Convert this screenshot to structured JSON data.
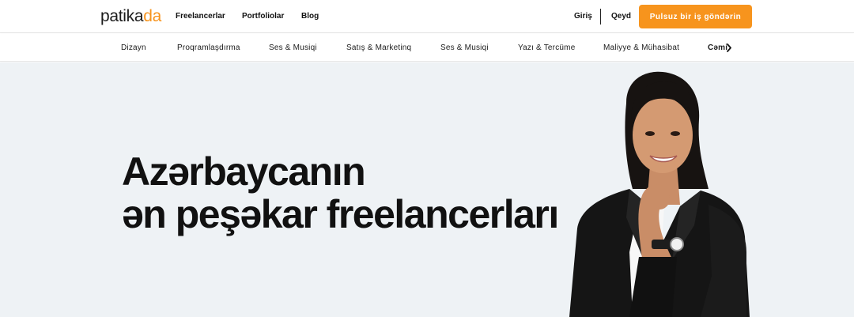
{
  "logo": {
    "part1": "patika",
    "part2": "da"
  },
  "header": {
    "nav": [
      "Freelancerlar",
      "Portfoliolar",
      "Blog"
    ],
    "login": "Giriş",
    "register": "Qeyd",
    "cta": "Pulsuz bir iş göndərin"
  },
  "categories": [
    "Dizayn",
    "Proqramlaşdırma",
    "Ses & Musiqi",
    "Satış & Marketinq",
    "Ses & Musiqi",
    "Yazı & Tercüme",
    "Maliyye & Mühasibat",
    "Cəmi"
  ],
  "hero": {
    "line1": "Azərbaycanın",
    "line2": "ən peşəkar freelancerları"
  },
  "colors": {
    "accent": "#f7941d",
    "hero_bg": "#eef2f5",
    "text": "#111111"
  },
  "icons": {
    "more": "chevron-right-icon"
  }
}
